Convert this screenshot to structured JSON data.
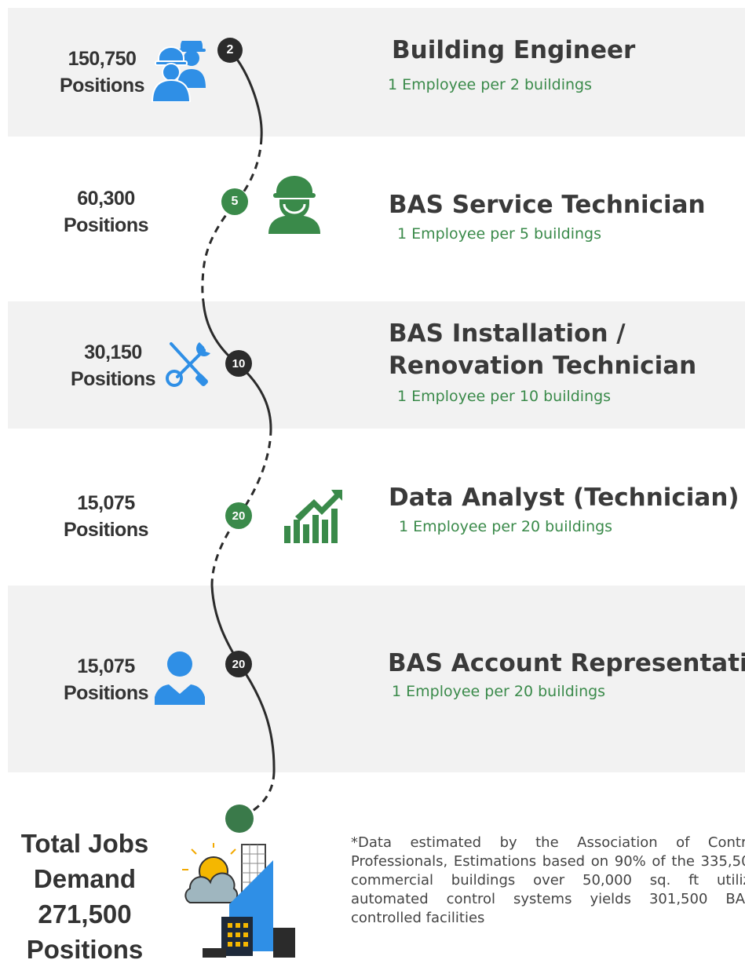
{
  "roles": [
    {
      "positions_number": "150,750",
      "positions_word": "Positions",
      "title_line1": "Building Engineer",
      "title_line2": "",
      "ratio_text": "1 Employee per 2 buildings",
      "marker": "2",
      "marker_style": "dark",
      "icon": "workers-hardhat-icon"
    },
    {
      "positions_number": "60,300",
      "positions_word": "Positions",
      "title_line1": "BAS Service Technician",
      "title_line2": "",
      "ratio_text": "1 Employee per 5 buildings",
      "marker": "5",
      "marker_style": "green",
      "icon": "technician-hardhat-icon"
    },
    {
      "positions_number": "30,150",
      "positions_word": "Positions",
      "title_line1": "BAS Installation /",
      "title_line2": "Renovation Technician",
      "ratio_text": "1 Employee per 10 buildings",
      "marker": "10",
      "marker_style": "dark",
      "icon": "tools-icon"
    },
    {
      "positions_number": "15,075",
      "positions_word": "Positions",
      "title_line1": "Data Analyst (Technician)",
      "title_line2": "",
      "ratio_text": "1 Employee per 20 buildings",
      "marker": "20",
      "marker_style": "green",
      "icon": "growth-chart-icon"
    },
    {
      "positions_number": "15,075",
      "positions_word": "Positions",
      "title_line1": "BAS Account Representative",
      "title_line2": "",
      "ratio_text": "1 Employee per 20 buildings",
      "marker": "20",
      "marker_style": "dark",
      "icon": "person-icon"
    }
  ],
  "total": {
    "line1": "Total Jobs",
    "line2": "Demand",
    "line3": "271,500",
    "line4": "Positions"
  },
  "footnote": "*Data estimated by the Association of Control Professionals, Estimations based on 90% of the 335,500 commercial buildings over 50,000 sq. ft utilize automated control systems yields 301,500 BAS-controlled facilities",
  "colors": {
    "band": "#f2f2f2",
    "dark_marker": "#2b2b2b",
    "green_marker": "#3a8a4a",
    "blue_icon": "#2f8fe6",
    "green_icon": "#3a8a4a",
    "subtitle": "#3a8a4a"
  }
}
